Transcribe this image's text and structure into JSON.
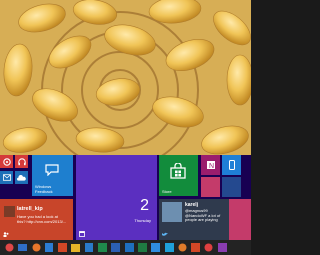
{
  "tiles": {
    "small": [
      {
        "name": "music-icon",
        "color": "#d43a3a"
      },
      {
        "name": "headphones-icon",
        "color": "#d43a3a"
      },
      {
        "name": "mail-icon",
        "color": "#1e6fb8"
      },
      {
        "name": "cloud-icon",
        "color": "#1e6fb8"
      }
    ],
    "feedback": {
      "label": "Windows\nFeedback",
      "color": "#1e7fcf"
    },
    "people": {
      "user": "latrell_kip",
      "message": "Have you had a look at this? http://cnn.com/2013/...",
      "color": "#c8452a"
    },
    "calendar": {
      "day": "2",
      "weekday": "Thursday",
      "color": "#5b2fc0"
    },
    "store": {
      "label": "Store",
      "color": "#128c3c"
    },
    "twitter": {
      "user": "karelj",
      "message": "@magnus99\n@NandoWF a lot of people are playing",
      "color": "#2f3a4d"
    }
  },
  "taskbar": {
    "icons": [
      "start-icon",
      "desktop-icon",
      "browser-icon",
      "onenote-icon",
      "store-icon",
      "file-explorer-icon",
      "onenote-icon",
      "excel-icon",
      "word-icon",
      "outlook-icon",
      "excel-icon",
      "mail-icon",
      "photos-icon",
      "settings-icon",
      "powerpoint-icon",
      "pinterest-icon",
      "onenote-icon"
    ]
  }
}
